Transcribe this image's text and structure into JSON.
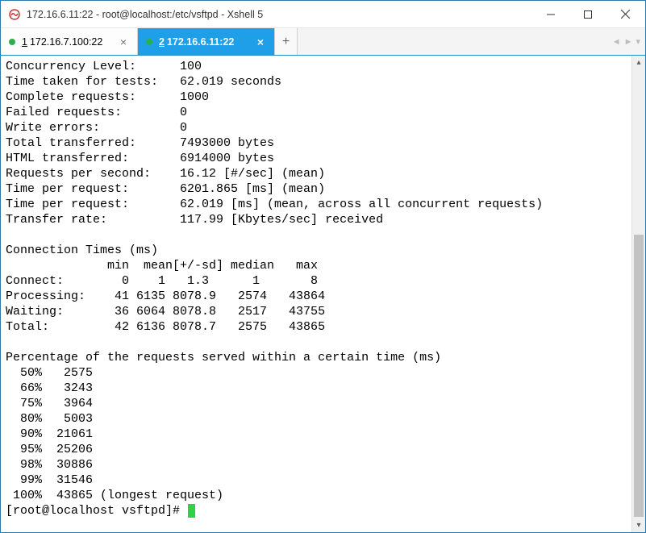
{
  "window": {
    "title": "172.16.6.11:22 - root@localhost:/etc/vsftpd - Xshell 5"
  },
  "tabs": [
    {
      "num": "1",
      "label": "172.16.7.100:22",
      "active": false
    },
    {
      "num": "2",
      "label": "172.16.6.11:22",
      "active": true
    }
  ],
  "terminal": {
    "stats": [
      {
        "label": "Concurrency Level:      ",
        "value": "100"
      },
      {
        "label": "Time taken for tests:   ",
        "value": "62.019 seconds"
      },
      {
        "label": "Complete requests:      ",
        "value": "1000"
      },
      {
        "label": "Failed requests:        ",
        "value": "0"
      },
      {
        "label": "Write errors:           ",
        "value": "0"
      },
      {
        "label": "Total transferred:      ",
        "value": "7493000 bytes"
      },
      {
        "label": "HTML transferred:       ",
        "value": "6914000 bytes"
      },
      {
        "label": "Requests per second:    ",
        "value": "16.12 [#/sec] (mean)"
      },
      {
        "label": "Time per request:       ",
        "value": "6201.865 [ms] (mean)"
      },
      {
        "label": "Time per request:       ",
        "value": "62.019 [ms] (mean, across all concurrent requests)"
      },
      {
        "label": "Transfer rate:          ",
        "value": "117.99 [Kbytes/sec] received"
      }
    ],
    "conn_heading": "Connection Times (ms)",
    "conn_header": "              min  mean[+/-sd] median   max",
    "conn_rows": [
      "Connect:        0    1   1.3      1       8",
      "Processing:    41 6135 8078.9   2574   43864",
      "Waiting:       36 6064 8078.8   2517   43755",
      "Total:         42 6136 8078.7   2575   43865"
    ],
    "pct_heading": "Percentage of the requests served within a certain time (ms)",
    "pct_rows": [
      "  50%   2575",
      "  66%   3243",
      "  75%   3964",
      "  80%   5003",
      "  90%  21061",
      "  95%  25206",
      "  98%  30886",
      "  99%  31546",
      " 100%  43865 (longest request)"
    ],
    "prompt": "[root@localhost vsftpd]# "
  }
}
